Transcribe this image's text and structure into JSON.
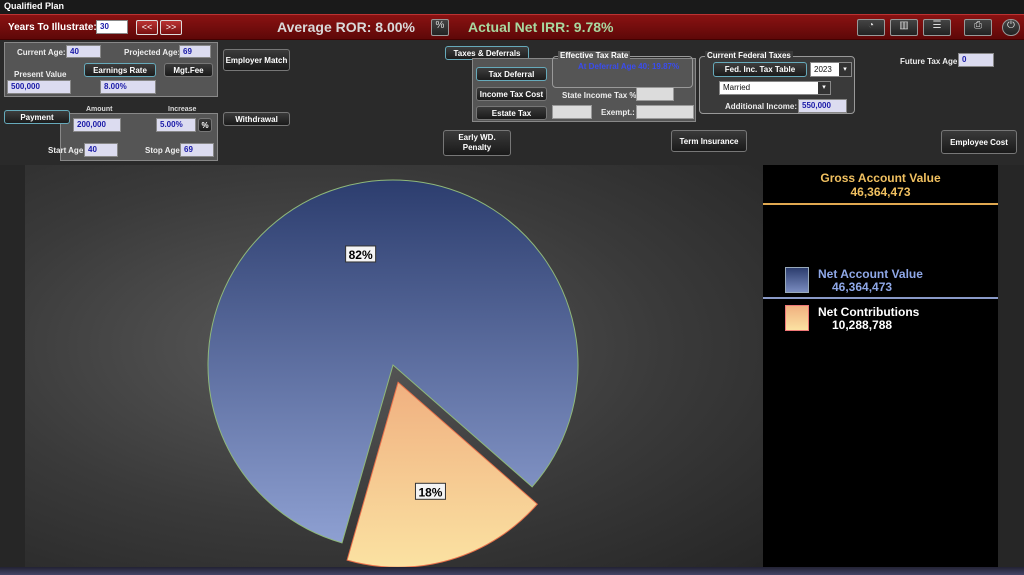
{
  "window": {
    "title": "Qualified Plan"
  },
  "topbar": {
    "years_label": "Years To Illustrate:",
    "years_value": "30",
    "prev_label": "<<",
    "next_label": ">>",
    "avg_ror": "Average ROR: 8.00%",
    "net_irr": "Actual Net IRR: 9.78%"
  },
  "inputs": {
    "current_age_label": "Current Age:",
    "current_age": "40",
    "projected_age_label": "Projected Age:",
    "projected_age": "69",
    "present_value_label": "Present Value",
    "present_value": "500,000",
    "earnings_rate_label": "Earnings Rate",
    "earnings_rate": "8.00%",
    "mgt_fee_label": "Mgt.Fee",
    "employer_match_label": "Employer Match",
    "amount_label": "Amount",
    "increase_label": "Increase",
    "payment_label": "Payment",
    "payment_amount": "200,000",
    "payment_increase": "5.00%",
    "percent_toggle": "%",
    "withdrawal_label": "Withdrawal",
    "start_age_label": "Start Age:",
    "start_age": "40",
    "stop_age_label": "Stop Age:",
    "stop_age": "69",
    "taxes_deferrals_label": "Taxes & Deferrals",
    "tax_deferral_label": "Tax Deferral",
    "income_tax_cost_label": "Income Tax Cost",
    "estate_tax_label": "Estate Tax",
    "effective_tax_rate_title": "Effective Tax Rate",
    "deferral_age_text": "At Deferral Age 40: 19.87%",
    "state_income_tax_label": "State Income Tax %:",
    "exempt_label": "Exempt.:",
    "current_federal_taxes_title": "Current Federal Taxes",
    "fed_tax_table_label": "Fed. Inc. Tax Table",
    "tax_year": "2023",
    "filing_status": "Married",
    "additional_income_label": "Additional Income:",
    "additional_income": "550,000",
    "future_tax_age_label": "Future Tax Age:",
    "future_tax_age": "0",
    "early_wd_label": "Early WD. Penalty",
    "term_insurance_label": "Term Insurance",
    "employee_cost_label": "Employee Cost"
  },
  "legend": {
    "gross_title": "Gross Account Value",
    "gross_value": "46,364,473",
    "net_account_label": "Net Account Value",
    "net_account_value": "46,364,473",
    "net_contrib_label": "Net Contributions",
    "net_contrib_value": "10,288,788"
  },
  "colors": {
    "net_account": "#4a5f94",
    "net_contributions": "#f5c890",
    "gross_title": "#f0c060",
    "topbar_red": "#7a0e0e"
  },
  "chart_data": {
    "type": "pie",
    "title": "",
    "series": [
      {
        "name": "Net Account Value",
        "value": 82,
        "label": "82%"
      },
      {
        "name": "Net Contributions",
        "value": 18,
        "label": "18%",
        "exploded": true
      }
    ]
  }
}
